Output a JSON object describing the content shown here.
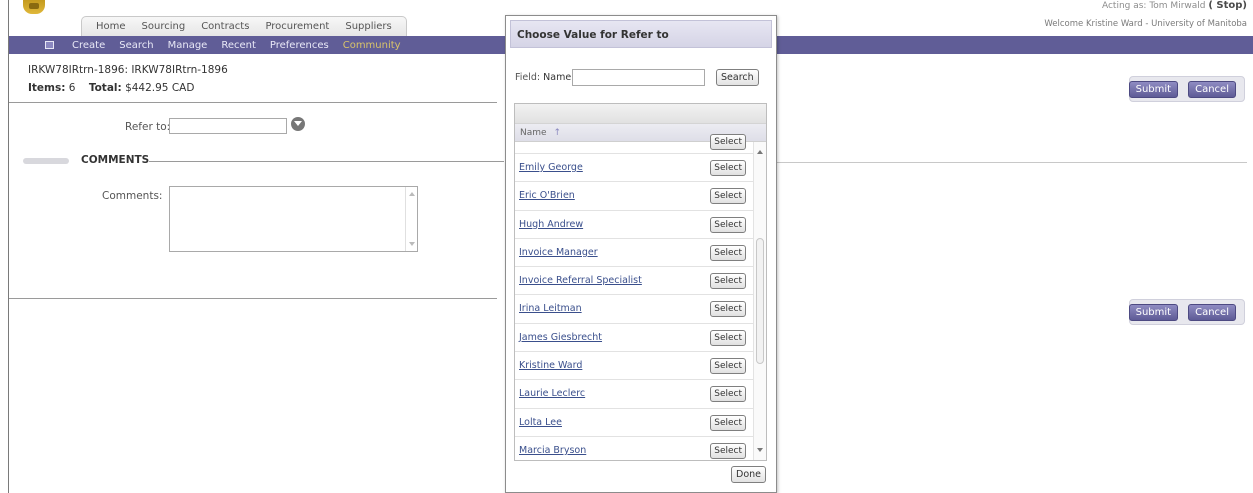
{
  "header": {
    "tabs": [
      "Home",
      "Sourcing",
      "Contracts",
      "Procurement",
      "Suppliers"
    ],
    "acting_as": "Acting as: Tom Mirwald",
    "stop_label": "( Stop)",
    "welcome": "Welcome Kristine Ward - University of Manitoba"
  },
  "nav": {
    "items": [
      "Create",
      "Search",
      "Manage",
      "Recent",
      "Preferences",
      "Community"
    ],
    "active": "Community"
  },
  "document": {
    "title": "IRKW78IRtrn-1896: IRKW78IRtrn-1896",
    "items_label": "Items:",
    "items_value": "6",
    "total_label": "Total:",
    "total_value": "$442.95 CAD"
  },
  "actions": {
    "submit_label": "Submit",
    "cancel_label": "Cancel"
  },
  "form": {
    "refer_label": "Refer to:",
    "refer_value": "",
    "comments_section": "COMMENTS",
    "comments_label": "Comments:",
    "comments_value": ""
  },
  "modal": {
    "title": "Choose Value for Refer to",
    "field_label": "Field:",
    "field_name": "Name",
    "search_value": "",
    "search_label": "Search",
    "column_header": "Name",
    "sort_indicator": "↑",
    "select_label": "Select",
    "done_label": "Done",
    "rows": [
      "Emily George",
      "Eric O'Brien",
      "Hugh Andrew",
      "Invoice Manager",
      "Invoice Referral Specialist",
      "Irina Leitman",
      "James Giesbrecht",
      "Kristine Ward",
      "Laurie Leclerc",
      "Lolta Lee",
      "Marcia Bryson"
    ]
  },
  "colors": {
    "nav_bg": "#605d97",
    "nav_active": "#d9c46a",
    "link": "#3a4f8c",
    "button": "#5e5b96"
  }
}
